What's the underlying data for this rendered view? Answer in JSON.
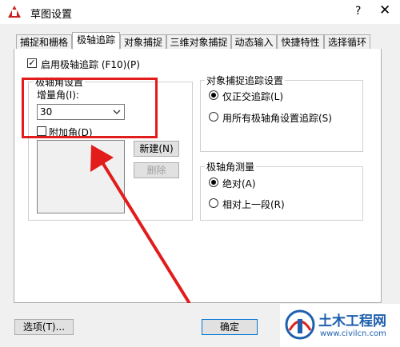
{
  "window": {
    "title": "草图设置",
    "help_label": "?",
    "close_label": "✕"
  },
  "tabs": [
    {
      "label": "捕捉和栅格"
    },
    {
      "label": "极轴追踪"
    },
    {
      "label": "对象捕捉"
    },
    {
      "label": "三维对象捕捉"
    },
    {
      "label": "动态输入"
    },
    {
      "label": "快捷特性"
    },
    {
      "label": "选择循环"
    }
  ],
  "polar": {
    "enable_label": "启用极轴追踪 (F10)(P)",
    "enabled": true,
    "group_title": "极轴角设置",
    "increment_label": "增量角(I):",
    "increment_value": "30",
    "additional_label": "附加角(D)",
    "additional_checked": false,
    "new_label": "新建(N)",
    "delete_label": "删除"
  },
  "osnap_tracking": {
    "group_title": "对象捕捉追踪设置",
    "options": [
      {
        "label": "仅正交追踪(L)",
        "selected": true
      },
      {
        "label": "用所有极轴角设置追踪(S)",
        "selected": false
      }
    ]
  },
  "polar_measure": {
    "group_title": "极轴角测量",
    "options": [
      {
        "label": "绝对(A)",
        "selected": true
      },
      {
        "label": "相对上一段(R)",
        "selected": false
      }
    ]
  },
  "footer": {
    "options_label": "选项(T)...",
    "ok_label": "确定"
  },
  "watermark": {
    "title": "土木工程网",
    "url": "www.civilcn.com"
  },
  "colors": {
    "annotation_red": "#e21b1b",
    "logo_blue": "#1e5fae"
  }
}
